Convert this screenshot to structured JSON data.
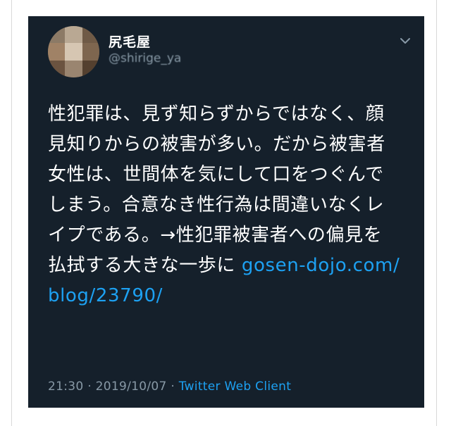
{
  "user": {
    "display_name": "尻毛屋",
    "handle": "@shirige_ya"
  },
  "tweet": {
    "text": "性犯罪は、見ず知らずからではなく、顔見知りからの被害が多い。だから被害者女性は、世間体を気にして口をつぐんでしまう。合意なき性行為は間違いなくレイプである。→性犯罪被害者への偏見を払拭する大きな一歩に ",
    "link_text": "gosen-dojo.com/blog/23790/"
  },
  "meta": {
    "time": "21:30",
    "separator1": " · ",
    "date": "2019/10/07",
    "separator2": " · ",
    "client": "Twitter Web Client"
  },
  "icons": {
    "menu": "chevron-down-icon"
  },
  "colors": {
    "background": "#15202b",
    "text": "#ffffff",
    "secondary": "#8899a6",
    "link": "#1da1f2"
  }
}
